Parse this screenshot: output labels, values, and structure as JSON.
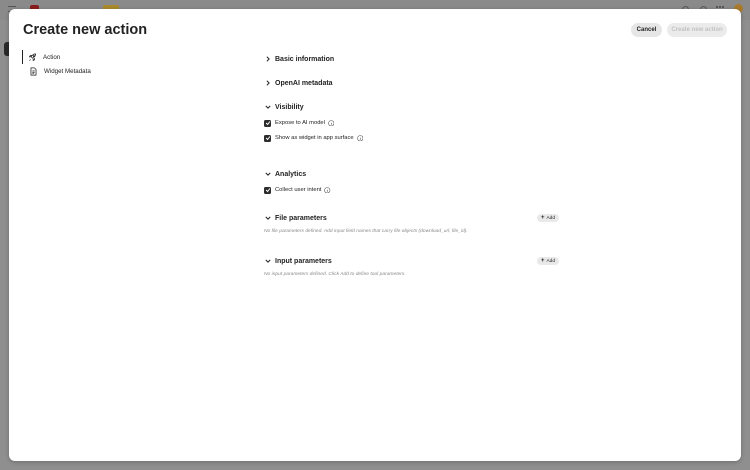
{
  "modal": {
    "title": "Create new action",
    "cancel_label": "Cancel",
    "create_label": "Create new action"
  },
  "nav": {
    "items": [
      {
        "label": "Action",
        "icon": "rocket-icon"
      },
      {
        "label": "Widget Metadata",
        "icon": "document-icon"
      }
    ]
  },
  "sections": {
    "basic_information": {
      "title": "Basic information",
      "expanded": false
    },
    "openai_metadata": {
      "title": "OpenAI metadata",
      "expanded": false
    },
    "visibility": {
      "title": "Visibility",
      "expanded": true,
      "options": [
        {
          "label": "Expose to AI model",
          "checked": true
        },
        {
          "label": "Show as widget in app surface",
          "checked": true
        }
      ]
    },
    "analytics": {
      "title": "Analytics",
      "expanded": true,
      "options": [
        {
          "label": "Collect user intent",
          "checked": true
        }
      ]
    },
    "file_parameters": {
      "title": "File parameters",
      "expanded": true,
      "add_label": "Add",
      "empty_text": "No file parameters defined. Add input field names that carry file objects (download_url, file_id)."
    },
    "input_parameters": {
      "title": "Input parameters",
      "expanded": true,
      "add_label": "Add",
      "empty_text": "No input parameters defined. Click Add to define tool parameters."
    }
  },
  "colors": {
    "overlay": "#8f8f8f",
    "modal_bg": "#ffffff",
    "checkbox": "#2c2c2c",
    "muted_text": "#8a8a8a"
  }
}
